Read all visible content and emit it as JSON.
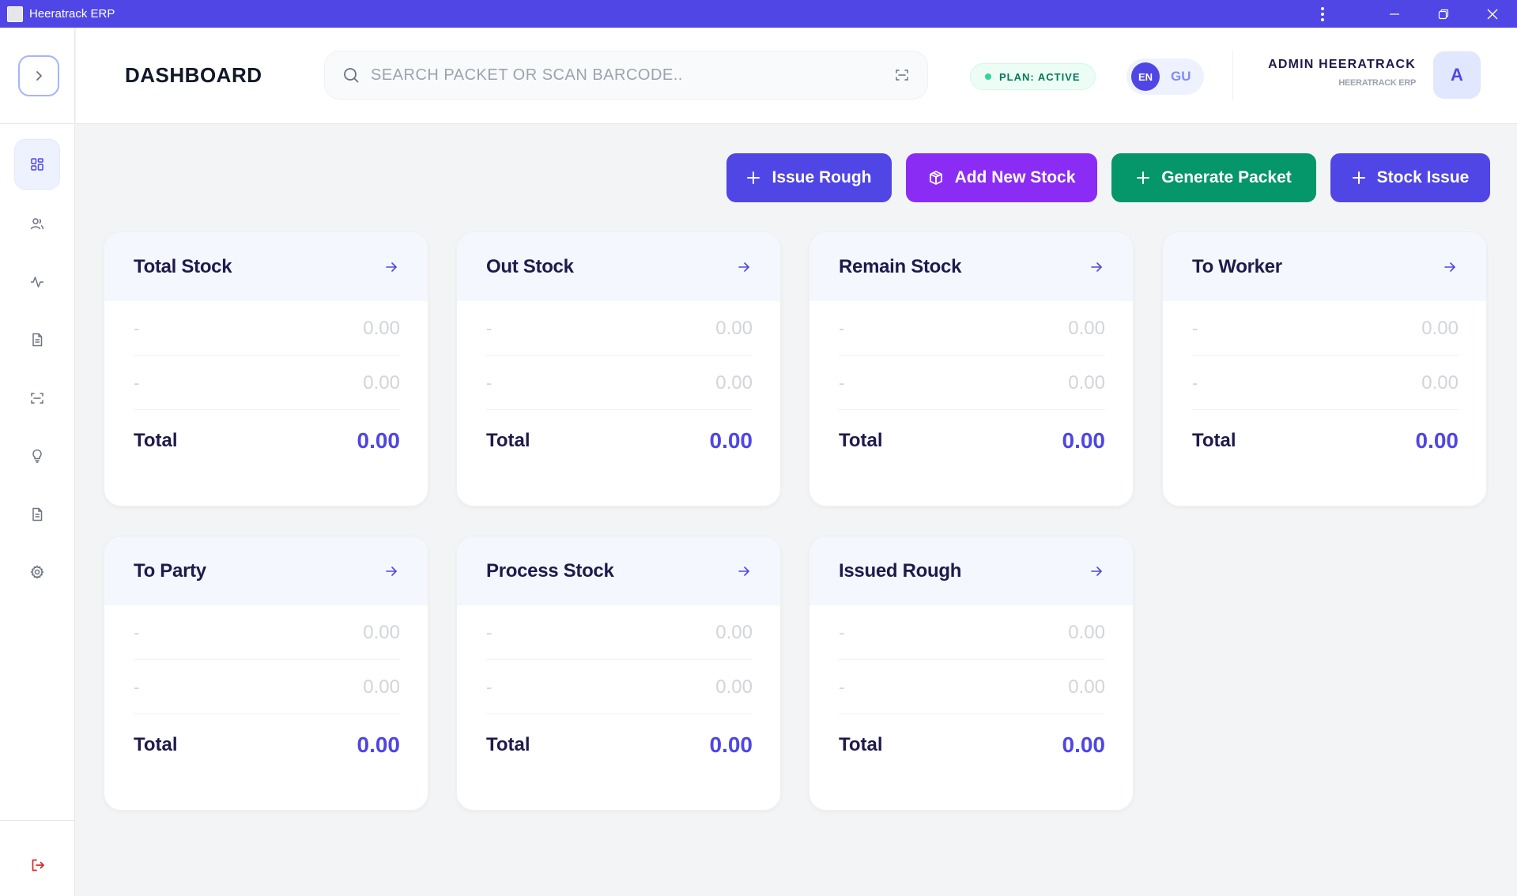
{
  "window": {
    "title": "Heeratrack ERP"
  },
  "header": {
    "page_title": "DASHBOARD",
    "search_placeholder": "SEARCH PACKET OR SCAN BARCODE..",
    "plan_label": "PLAN: ACTIVE",
    "lang_en": "EN",
    "lang_gu": "GU",
    "user_name": "ADMIN HEERATRACK",
    "company": "HEERATRACK ERP",
    "avatar_initial": "A"
  },
  "sidebar": {
    "items": [
      {
        "icon": "dashboard-icon",
        "active": true
      },
      {
        "icon": "users-icon",
        "active": false
      },
      {
        "icon": "activity-icon",
        "active": false
      },
      {
        "icon": "document-icon",
        "active": false
      },
      {
        "icon": "scan-icon",
        "active": false
      },
      {
        "icon": "lightbulb-icon",
        "active": false
      },
      {
        "icon": "report-icon",
        "active": false
      },
      {
        "icon": "settings-icon",
        "active": false
      }
    ],
    "logout_icon": "logout-icon"
  },
  "actions": {
    "issue_rough": "Issue Rough",
    "add_new_stock": "Add New Stock",
    "generate_packet": "Generate Packet",
    "stock_issue": "Stock Issue"
  },
  "cards": [
    {
      "title": "Total Stock",
      "rows": [
        {
          "label": "-",
          "value": "0.00"
        },
        {
          "label": "-",
          "value": "0.00"
        }
      ],
      "total_label": "Total",
      "total_value": "0.00"
    },
    {
      "title": "Out Stock",
      "rows": [
        {
          "label": "-",
          "value": "0.00"
        },
        {
          "label": "-",
          "value": "0.00"
        }
      ],
      "total_label": "Total",
      "total_value": "0.00"
    },
    {
      "title": "Remain Stock",
      "rows": [
        {
          "label": "-",
          "value": "0.00"
        },
        {
          "label": "-",
          "value": "0.00"
        }
      ],
      "total_label": "Total",
      "total_value": "0.00"
    },
    {
      "title": "To Worker",
      "rows": [
        {
          "label": "-",
          "value": "0.00"
        },
        {
          "label": "-",
          "value": "0.00"
        }
      ],
      "total_label": "Total",
      "total_value": "0.00"
    },
    {
      "title": "To Party",
      "rows": [
        {
          "label": "-",
          "value": "0.00"
        },
        {
          "label": "-",
          "value": "0.00"
        }
      ],
      "total_label": "Total",
      "total_value": "0.00"
    },
    {
      "title": "Process Stock",
      "rows": [
        {
          "label": "-",
          "value": "0.00"
        },
        {
          "label": "-",
          "value": "0.00"
        }
      ],
      "total_label": "Total",
      "total_value": "0.00"
    },
    {
      "title": "Issued Rough",
      "rows": [
        {
          "label": "-",
          "value": "0.00"
        },
        {
          "label": "-",
          "value": "0.00"
        }
      ],
      "total_label": "Total",
      "total_value": "0.00"
    }
  ],
  "colors": {
    "primary": "#4f46e5",
    "purple": "#8b2cf5",
    "green": "#059669",
    "danger": "#dc2626"
  }
}
